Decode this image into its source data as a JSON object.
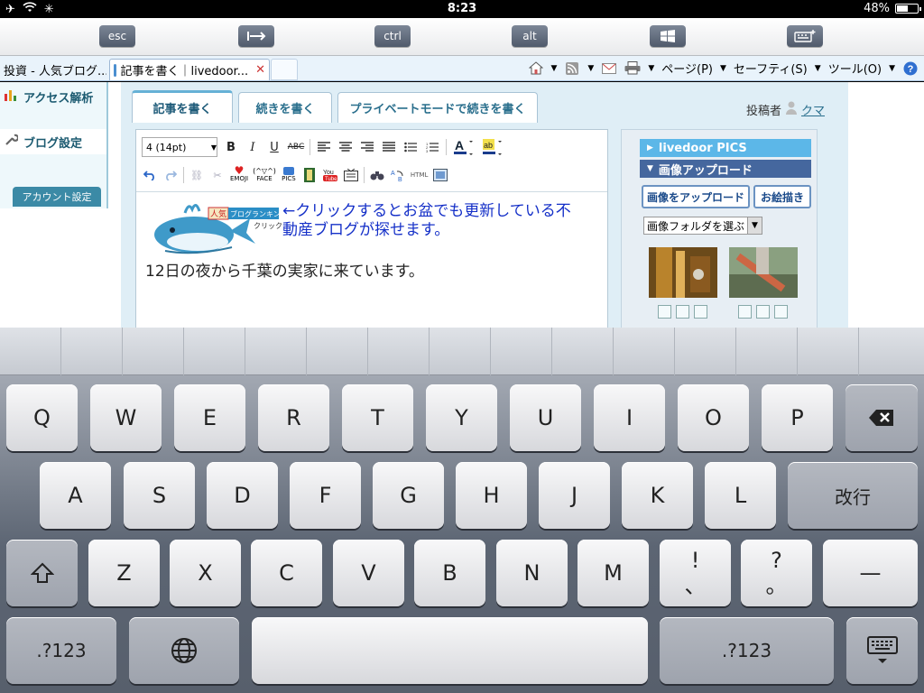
{
  "status": {
    "time": "8:23",
    "battery": "48%",
    "battery_level": 0.48,
    "icons": [
      "airplane-icon",
      "wifi-icon",
      "activity-icon"
    ]
  },
  "remote_keys": {
    "esc": "esc",
    "tab_icon": "tab-switch-icon",
    "ctrl": "ctrl",
    "alt": "alt",
    "win_icon": "windows-icon",
    "kb_icon": "keyboard-plus-icon"
  },
  "browser": {
    "tabs": [
      {
        "label": "投資 - 人気ブログ..."
      },
      {
        "label": "記事を書く｜livedoor..."
      }
    ],
    "toolbar": {
      "page": "ページ(P)",
      "safety": "セーフティ(S)",
      "tools": "ツール(O)"
    }
  },
  "sidebar": {
    "access": "アクセス解析",
    "blog_settings": "ブログ設定",
    "account": "アカウント設定"
  },
  "editor": {
    "tabs": [
      "記事を書く",
      "続きを書く",
      "プライベートモードで続きを書く"
    ],
    "poster_label": "投稿者",
    "poster_name": "クマ",
    "font_size": "4 (14pt)",
    "tb_labels": {
      "emoji": "EMOJI",
      "face": "FACE",
      "pics": "PICS",
      "html": "HTML"
    },
    "banner_text_1": "人気",
    "banner_text_2": "ブログランキング",
    "banner_text_3": "クリック",
    "link_text": "←クリックするとお盆でも更新している不動産ブログが探せます。",
    "body_text": "12日の夜から千葉の実家に来ています。"
  },
  "pics_panel": {
    "header": "livedoor PICS",
    "upload_header": "画像アップロード",
    "upload_btn": "画像をアップロード",
    "draw_btn": "お絵描き",
    "folder_select": "画像フォルダを選ぶ"
  },
  "keyboard": {
    "row1": [
      "Q",
      "W",
      "E",
      "R",
      "T",
      "Y",
      "U",
      "I",
      "O",
      "P"
    ],
    "row2": [
      "A",
      "S",
      "D",
      "F",
      "G",
      "H",
      "J",
      "K",
      "L"
    ],
    "return": "改行",
    "row3": [
      "Z",
      "X",
      "C",
      "V",
      "B",
      "N",
      "M"
    ],
    "excl": "!",
    "excl_sub": "、",
    "q": "?",
    "q_sub": "。",
    "dash": "—",
    "num_left": ".?123",
    "num_right": ".?123"
  }
}
